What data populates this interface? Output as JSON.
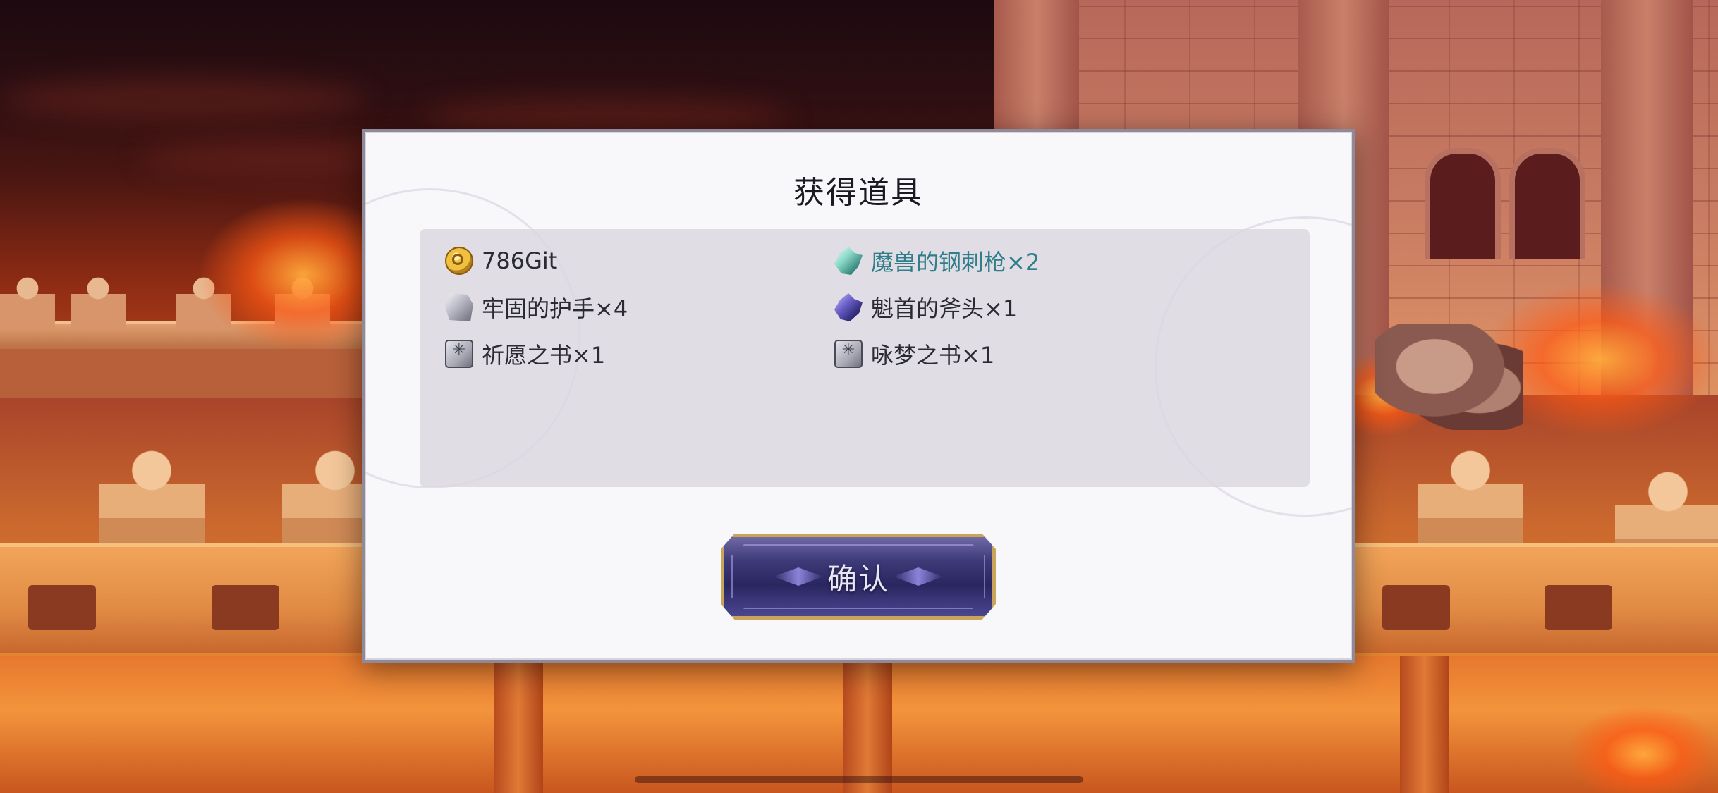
{
  "dialog": {
    "title": "获得道具",
    "confirm_label": "确认"
  },
  "items": [
    {
      "icon": "coin-icon",
      "label": "786Git",
      "highlight": false
    },
    {
      "icon": "steel-spear-crystal-icon",
      "label": "魔兽的钢刺枪×2",
      "highlight": true
    },
    {
      "icon": "gauntlet-icon",
      "label": "牢固的护手×4",
      "highlight": false
    },
    {
      "icon": "axe-head-crystal-icon",
      "label": "魁首的斧头×1",
      "highlight": false
    },
    {
      "icon": "book-icon",
      "label": "祈愿之书×1",
      "highlight": false
    },
    {
      "icon": "book-icon",
      "label": "咏梦之书×1",
      "highlight": false
    }
  ],
  "colors": {
    "dialog_bg": "#f8f7fa",
    "highlight_text": "#2f7e8a",
    "button_border": "#caa45a",
    "button_fill": "#2a2660"
  }
}
